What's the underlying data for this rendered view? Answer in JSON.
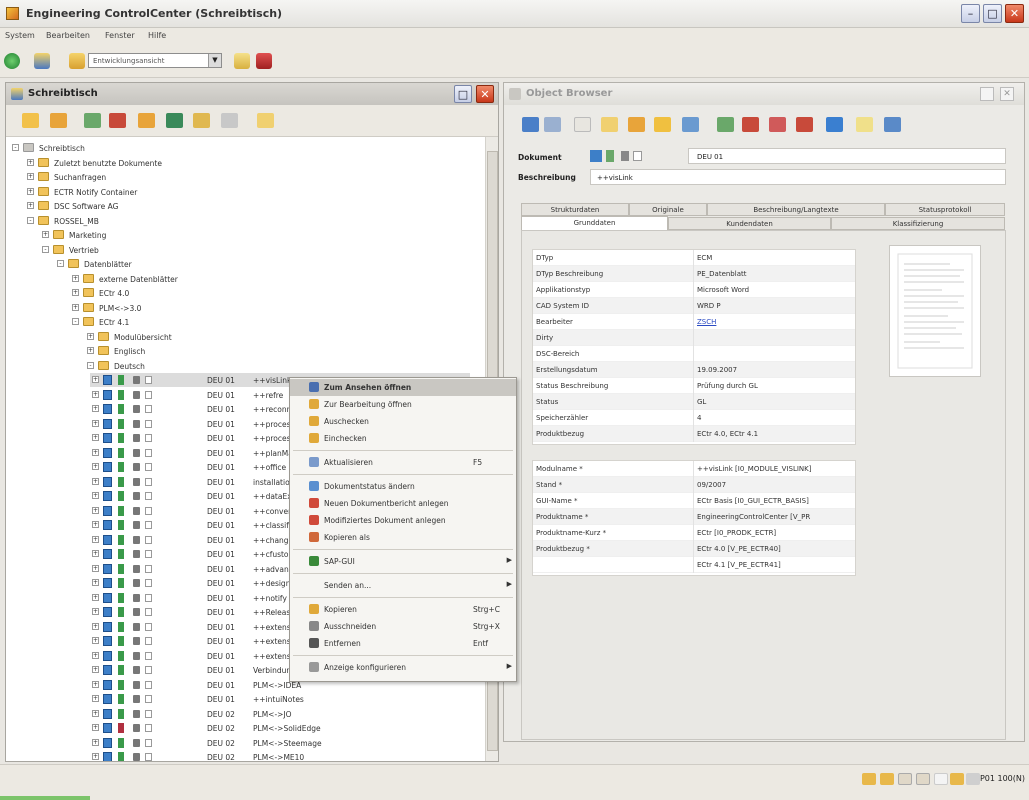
{
  "app": {
    "title": "Engineering ControlCenter (Schreibtisch)"
  },
  "menu": [
    "System",
    "Bearbeiten",
    "Fenster",
    "Hilfe"
  ],
  "toolbar": {
    "dropdown_value": "Entwicklungsansicht"
  },
  "left_panel": {
    "title": "Schreibtisch",
    "tree": [
      {
        "label": "Schreibtisch",
        "level": 0,
        "expander": "-",
        "kind": "root"
      },
      {
        "label": "Zuletzt benutzte Dokumente",
        "level": 1,
        "expander": "+",
        "kind": "folder"
      },
      {
        "label": "Suchanfragen",
        "level": 1,
        "expander": "+",
        "kind": "folder"
      },
      {
        "label": "ECTR Notify Container",
        "level": 1,
        "expander": "+",
        "kind": "folder"
      },
      {
        "label": "DSC Software AG",
        "level": 1,
        "expander": "+",
        "kind": "folder"
      },
      {
        "label": "ROSSEL_MB",
        "level": 1,
        "expander": "-",
        "kind": "folder"
      },
      {
        "label": "Marketing",
        "level": 2,
        "expander": "+",
        "kind": "folder"
      },
      {
        "label": "Vertrieb",
        "level": 2,
        "expander": "-",
        "kind": "folder"
      },
      {
        "label": "Datenblätter",
        "level": 3,
        "expander": "-",
        "kind": "folder"
      },
      {
        "label": "externe Datenblätter",
        "level": 4,
        "expander": "+",
        "kind": "folder"
      },
      {
        "label": "ECtr 4.0",
        "level": 4,
        "expander": "+",
        "kind": "folder"
      },
      {
        "label": "PLM<->3.0",
        "level": 4,
        "expander": "+",
        "kind": "folder"
      },
      {
        "label": "ECtr 4.1",
        "level": 4,
        "expander": "-",
        "kind": "folder"
      },
      {
        "label": "Modulübersicht",
        "level": 5,
        "expander": "+",
        "kind": "folder"
      },
      {
        "label": "Englisch",
        "level": 5,
        "expander": "+",
        "kind": "folder"
      },
      {
        "label": "Deutsch",
        "level": 5,
        "expander": "-",
        "kind": "folder"
      }
    ],
    "docs": [
      {
        "code": "DEU 01",
        "name": "++visLink",
        "status": "green",
        "selected": true
      },
      {
        "code": "DEU 01",
        "name": "++refre",
        "status": "green"
      },
      {
        "code": "DEU 01",
        "name": "++reconn",
        "status": "green"
      },
      {
        "code": "DEU 01",
        "name": "++process",
        "status": "green"
      },
      {
        "code": "DEU 01",
        "name": "++process",
        "status": "green"
      },
      {
        "code": "DEU 01",
        "name": "++planMa",
        "status": "green"
      },
      {
        "code": "DEU 01",
        "name": "++office",
        "status": "green"
      },
      {
        "code": "DEU 01",
        "name": "installation",
        "status": "green"
      },
      {
        "code": "DEU 01",
        "name": "++dataEx",
        "status": "green"
      },
      {
        "code": "DEU 01",
        "name": "++convert",
        "status": "green"
      },
      {
        "code": "DEU 01",
        "name": "++classify",
        "status": "green"
      },
      {
        "code": "DEU 01",
        "name": "++change",
        "status": "green"
      },
      {
        "code": "DEU 01",
        "name": "++cfustom",
        "status": "green"
      },
      {
        "code": "DEU 01",
        "name": "++advanc",
        "status": "green"
      },
      {
        "code": "DEU 01",
        "name": "++designW",
        "status": "green"
      },
      {
        "code": "DEU 01",
        "name": "++notify",
        "status": "green"
      },
      {
        "code": "DEU 01",
        "name": "++Release",
        "status": "green"
      },
      {
        "code": "DEU 01",
        "name": "++extensi",
        "status": "green"
      },
      {
        "code": "DEU 01",
        "name": "++extensi",
        "status": "green"
      },
      {
        "code": "DEU 01",
        "name": "++extensi",
        "status": "green"
      },
      {
        "code": "DEU 01",
        "name": "Verbindun",
        "status": "green"
      },
      {
        "code": "DEU 01",
        "name": "PLM<->IDEA",
        "status": "green"
      },
      {
        "code": "DEU 01",
        "name": "++intuiNotes",
        "status": "green"
      },
      {
        "code": "DEU 02",
        "name": "PLM<->JO",
        "status": "green"
      },
      {
        "code": "DEU 02",
        "name": "PLM<->SolidEdge",
        "status": "red"
      },
      {
        "code": "DEU 02",
        "name": "PLM<->Steemage",
        "status": "green"
      },
      {
        "code": "DEU 02",
        "name": "PLM<->ME10",
        "status": "green"
      }
    ]
  },
  "object_browser": {
    "title": "Object Browser",
    "dokument_label": "Dokument",
    "dokument_code": "DEU 01",
    "beschreibung_label": "Beschreibung",
    "beschreibung_value": "++visLink",
    "tabs_row1": [
      "Strukturdaten",
      "Originale",
      "Beschreibung/Langtexte",
      "Statusprotokoll"
    ],
    "tabs_row2": [
      "Grunddaten",
      "Kundendaten",
      "Klassifizierung"
    ],
    "active_tab": "Grunddaten",
    "grid1": [
      {
        "k": "DTyp",
        "v": "ECM"
      },
      {
        "k": "DTyp Beschreibung",
        "v": "PE_Datenblatt"
      },
      {
        "k": "Applikationstyp",
        "v": "Microsoft Word"
      },
      {
        "k": "CAD System ID",
        "v": "WRD P"
      },
      {
        "k": "Bearbeiter",
        "v": "ZSCH",
        "link": true
      },
      {
        "k": "Dirty",
        "v": ""
      },
      {
        "k": "DSC-Bereich",
        "v": ""
      },
      {
        "k": "Erstellungsdatum",
        "v": "19.09.2007"
      },
      {
        "k": "Status Beschreibung",
        "v": "Prüfung durch GL"
      },
      {
        "k": "Status",
        "v": "GL"
      },
      {
        "k": "Speicherzähler",
        "v": "4"
      },
      {
        "k": "Produktbezug",
        "v": "ECtr 4.0, ECtr 4.1"
      }
    ],
    "grid2": [
      {
        "k": "Modulname *",
        "v": "++visLink [I0_MODULE_VISLINK]"
      },
      {
        "k": "Stand *",
        "v": "09/2007"
      },
      {
        "k": "GUI-Name *",
        "v": "ECtr Basis [I0_GUI_ECTR_BASIS]"
      },
      {
        "k": "Produktname *",
        "v": "EngineeringControlCenter [V_PR"
      },
      {
        "k": "Produktname-Kurz *",
        "v": "ECtr [I0_PRODK_ECTR]"
      },
      {
        "k": "Produktbezug *",
        "v": "ECtr 4.0 [V_PE_ECTR40]"
      },
      {
        "k": "",
        "v": "ECtr 4.1 [V_PE_ECTR41]"
      }
    ]
  },
  "context_menu": [
    {
      "label": "Zum Ansehen öffnen",
      "highlight": true,
      "icon": "#4a6fb0"
    },
    {
      "label": "Zur Bearbeitung öffnen",
      "icon": "#e0a93a"
    },
    {
      "label": "Auschecken",
      "icon": "#e0a93a"
    },
    {
      "label": "Einchecken",
      "icon": "#e0a93a"
    },
    {
      "sep": true
    },
    {
      "label": "Aktualisieren",
      "shortcut": "F5",
      "icon": "#7a9acb"
    },
    {
      "sep": true
    },
    {
      "label": "Dokumentstatus ändern",
      "icon": "#5a8fd0"
    },
    {
      "label": "Neuen Dokumentbericht anlegen",
      "icon": "#d04a3a"
    },
    {
      "label": "Modifiziertes Dokument anlegen",
      "icon": "#d04a3a"
    },
    {
      "label": "Kopieren als",
      "icon": "#d0683a"
    },
    {
      "sep": true
    },
    {
      "label": "SAP-GUI",
      "arrow": true,
      "icon": "#3a8a3a"
    },
    {
      "sep": true
    },
    {
      "label": "Senden an...",
      "arrow": true,
      "icon": ""
    },
    {
      "sep": true
    },
    {
      "label": "Kopieren",
      "shortcut": "Strg+C",
      "icon": "#e0a93a"
    },
    {
      "label": "Ausschneiden",
      "shortcut": "Strg+X",
      "icon": "#888888"
    },
    {
      "label": "Entfernen",
      "shortcut": "Entf",
      "icon": "#555555"
    },
    {
      "sep": true
    },
    {
      "label": "Anzeige konfigurieren",
      "arrow": true,
      "icon": "#999999"
    }
  ],
  "status_bar": {
    "text": "P01 100(N)"
  }
}
